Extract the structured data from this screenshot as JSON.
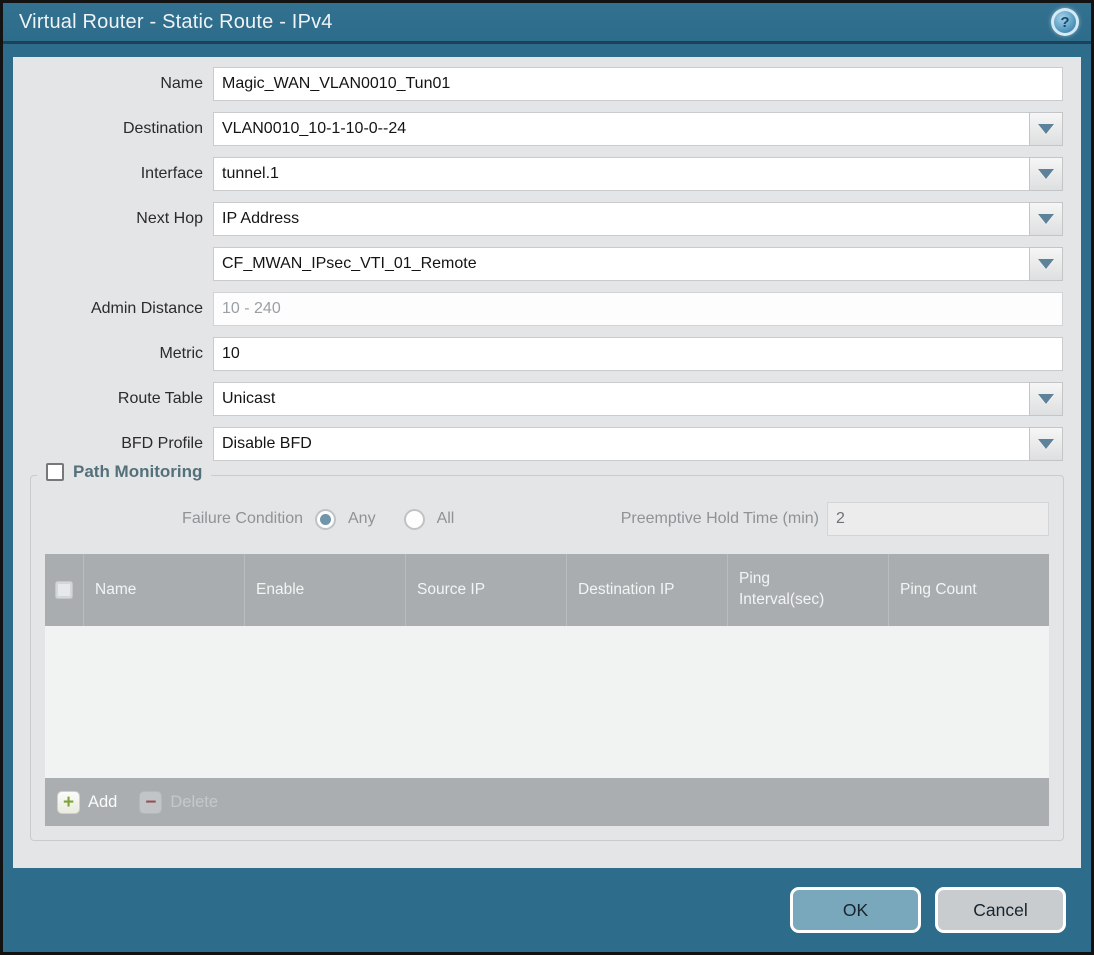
{
  "window": {
    "title": "Virtual Router - Static Route - IPv4",
    "ok_label": "OK",
    "cancel_label": "Cancel",
    "help_glyph": "?"
  },
  "form": {
    "name": {
      "label": "Name",
      "value": "Magic_WAN_VLAN0010_Tun01"
    },
    "destination": {
      "label": "Destination",
      "value": "VLAN0010_10-1-10-0--24"
    },
    "interface": {
      "label": "Interface",
      "value": "tunnel.1"
    },
    "next_hop": {
      "label": "Next Hop",
      "value": "IP Address",
      "address_value": "CF_MWAN_IPsec_VTI_01_Remote"
    },
    "admin_distance": {
      "label": "Admin Distance",
      "value": "",
      "placeholder": "10 - 240"
    },
    "metric": {
      "label": "Metric",
      "value": "10"
    },
    "route_table": {
      "label": "Route Table",
      "value": "Unicast"
    },
    "bfd_profile": {
      "label": "BFD Profile",
      "value": "Disable BFD"
    }
  },
  "path_monitoring": {
    "title": "Path Monitoring",
    "enabled": false,
    "failure_condition": {
      "label": "Failure Condition",
      "options": [
        {
          "label": "Any",
          "selected": true
        },
        {
          "label": "All",
          "selected": false
        }
      ]
    },
    "preemptive_hold_time": {
      "label": "Preemptive Hold Time (min)",
      "value": "2"
    },
    "table": {
      "columns": [
        "Name",
        "Enable",
        "Source IP",
        "Destination IP",
        "Ping Interval(sec)",
        "Ping Count"
      ],
      "rows": [],
      "add_label": "Add",
      "delete_label": "Delete"
    }
  },
  "colors": {
    "frame_teal": "#2e6c8b",
    "title_border": "#1b4257",
    "body_bg": "#e4e5e6",
    "table_header_bg": "#a9adb0",
    "ok_button": "#79a8bc",
    "cancel_button": "#c9cccf",
    "add_plus_green": "#7fa23a",
    "delete_minus_red": "#94505a",
    "dropdown_arrow": "#5e8299"
  }
}
